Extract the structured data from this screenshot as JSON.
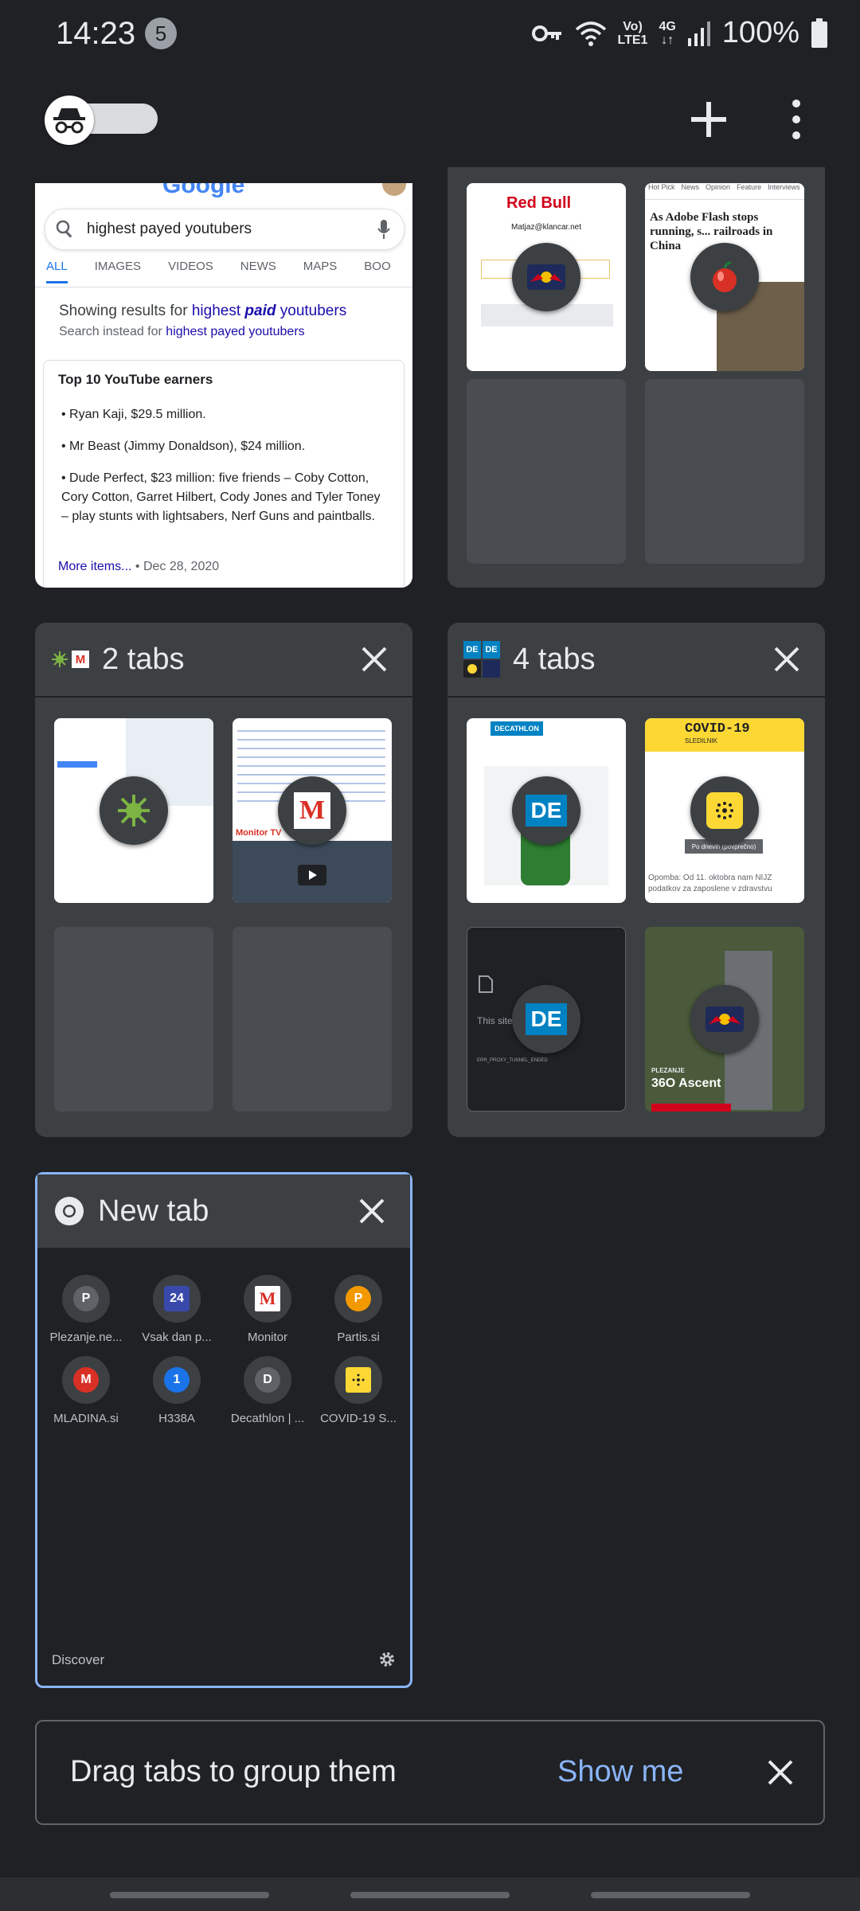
{
  "status_bar": {
    "time": "14:23",
    "notification_count": "5",
    "network_line1": "Vo)",
    "network_line2": "LTE1",
    "network_type": "4G",
    "battery": "100%"
  },
  "toolbar": {
    "incognito_icon": "incognito-icon",
    "add_icon": "plus-icon",
    "more_icon": "more-vert-icon"
  },
  "google_tab": {
    "search_query": "highest payed youtubers",
    "tabs": [
      "ALL",
      "IMAGES",
      "VIDEOS",
      "NEWS",
      "MAPS",
      "BOO"
    ],
    "showing_prefix": "Showing results for ",
    "showing_term_a": "highest ",
    "showing_term_b": "paid",
    "showing_term_c": " youtubers",
    "instead_prefix": "Search instead for ",
    "instead_term": "highest payed youtubers",
    "box_title": "Top 10 YouTube earners",
    "items": [
      "Ryan Kaji, $29.5 million.",
      "Mr Beast (Jimmy Donaldson), $24 million.",
      "Dude Perfect, $23 million: five friends – Coby Cotton, Cory Cotton, Garret Hilbert, Cody Jones and Tyler Toney – play stunts with lightsabers, Nerf Guns and paintballs."
    ],
    "more_items": "More items...",
    "date": " • Dec 28, 2020"
  },
  "redbull_group": {
    "thumb1_brand": "Red Bull",
    "thumb1_email": "Matjaz@klancar.net",
    "thumb2_nav": [
      "Hot Pick",
      "News",
      "Opinion",
      "Feature",
      "Interviews"
    ],
    "thumb2_headline": "As Adobe Flash stops running, s... railroads in China"
  },
  "group_two": {
    "title": "2 tabs",
    "thumb2_caption": "Monitor TV"
  },
  "group_four": {
    "title": "4 tabs",
    "decathlon_logo": "DECATHLON",
    "covid_title": "COVID-19",
    "covid_subtitle": "SLEDILNIK",
    "covid_button": "Po dnevih (povprečno)",
    "covid_note": "Opomba: Od 11. oktobra nam NIJZ podatkov za zaposlene v zdravstvu",
    "error_text": "This site",
    "error_code": "ERR_PROXY_TUNNEL_ENDED",
    "redbull_caption_small": "PLEZANJE",
    "redbull_caption": "36O Ascent",
    "de_label": "DE"
  },
  "new_tab": {
    "title": "New tab",
    "tiles": [
      {
        "letter": "P",
        "label": "Plezanje.ne...",
        "color": "#5f6368"
      },
      {
        "letter": "24",
        "label": "Vsak dan p...",
        "color": "#3949ab"
      },
      {
        "letter": "M",
        "label": "Monitor",
        "color": "#ffffff"
      },
      {
        "letter": "P",
        "label": "Partis.si",
        "color": "#f29900"
      },
      {
        "letter": "M",
        "label": "MLADINA.si",
        "color": "#d93025"
      },
      {
        "letter": "1",
        "label": "H338A",
        "color": "#1a73e8"
      },
      {
        "letter": "D",
        "label": "Decathlon | ...",
        "color": "#5f6368"
      },
      {
        "letter": "",
        "label": "COVID-19 S...",
        "color": "#fdd835"
      }
    ],
    "discover_label": "Discover",
    "settings_icon": "gear-icon"
  },
  "hint": {
    "text": "Drag tabs to group them",
    "action": "Show me"
  }
}
